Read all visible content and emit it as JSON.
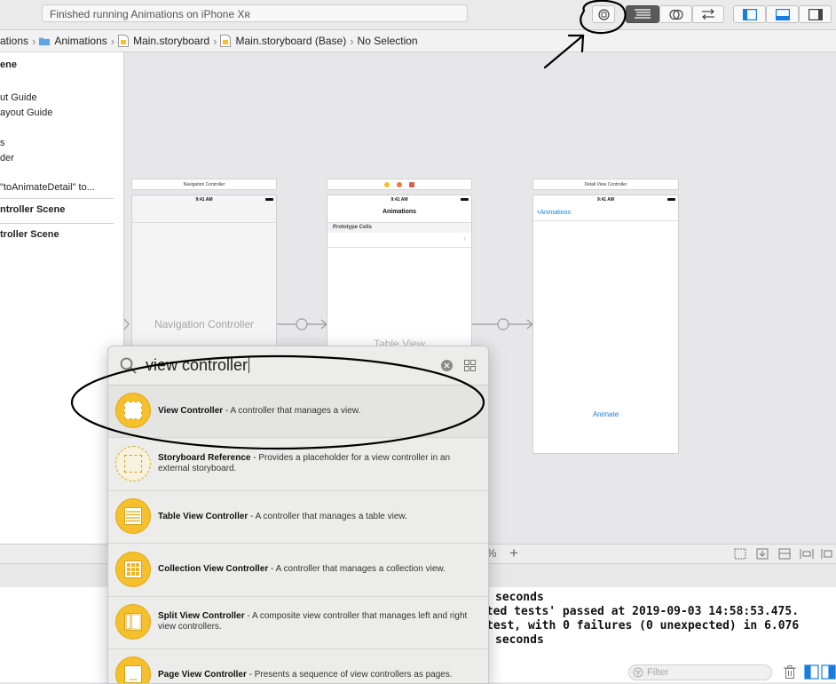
{
  "toolbar": {
    "status": "Finished running Animations on iPhone Xʀ"
  },
  "breadcrumb": {
    "items": [
      "ations",
      "Animations",
      "Main.storyboard",
      "Main.storyboard (Base)",
      "No Selection"
    ]
  },
  "outline": {
    "items": [
      "ene",
      "ut Guide",
      "ayout Guide",
      "s",
      "der",
      "\"toAnimateDetail\" to...",
      "ntroller Scene",
      "troller Scene"
    ]
  },
  "canvas": {
    "nav_title": "Navigation Controller",
    "nav_time": "9:41 AM",
    "nav_label": "Navigation Controller",
    "table_time": "9:41 AM",
    "table_navtitle": "Animations",
    "table_prototype": "Prototype Cells",
    "table_label": "Table View",
    "detail_title": "Detail View Controller",
    "detail_time": "9:41 AM",
    "detail_back": "Animations",
    "detail_button": "Animate"
  },
  "canvasbar": {
    "zoom_suffix": "%"
  },
  "console": {
    "lines": [
      "seconds",
      "cted tests' passed at 2019-09-03 14:58:53.475.",
      "test, with 0 failures (0 unexpected) in 6.076",
      "seconds"
    ],
    "filter_placeholder": "Filter"
  },
  "library": {
    "search_value": "view controller",
    "items": [
      {
        "title": "View Controller",
        "desc": " - A controller that manages a view.",
        "icon": "view-controller-icon"
      },
      {
        "title": "Storyboard Reference",
        "desc": " - Provides a placeholder for a view controller in an external storyboard.",
        "icon": "storyboard-reference-icon"
      },
      {
        "title": "Table View Controller",
        "desc": " - A controller that manages a table view.",
        "icon": "table-view-controller-icon"
      },
      {
        "title": "Collection View Controller",
        "desc": " - A controller that manages a collection view.",
        "icon": "collection-view-controller-icon"
      },
      {
        "title": "Split View Controller",
        "desc": " - A composite view controller that manages left and right view controllers.",
        "icon": "split-view-controller-icon"
      },
      {
        "title": "Page View Controller",
        "desc": " - Presents a sequence of view controllers as pages.",
        "icon": "page-view-controller-icon"
      }
    ]
  },
  "colors": {
    "accent": "#1a7ce0",
    "library_icon": "#f5c02c"
  }
}
